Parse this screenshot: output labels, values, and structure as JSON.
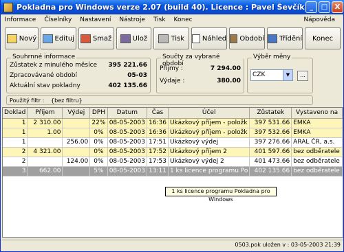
{
  "window": {
    "title": "Pokladna pro Windows verze 2.07 (build 40). Licence : Pavel Ševčík",
    "buttons": [
      "_",
      "□",
      "X"
    ]
  },
  "menu": {
    "items": [
      "Informace",
      "Číselníky",
      "Nastavení",
      "Nástroje",
      "Tisk",
      "Konec"
    ],
    "help": "Nápověda"
  },
  "toolbar": {
    "new": "Nový",
    "edit": "Edituj",
    "delete": "Smaž",
    "save": "Ulož",
    "print": "Tisk",
    "preview": "Náhled",
    "period": "Období",
    "sort": "Třídění",
    "exit": "Konec"
  },
  "summary": {
    "title": "Souhrnné informace",
    "rows": [
      {
        "label": "Zůstatek z minulého měsíce",
        "value": "395 221.66"
      },
      {
        "label": "Zpracovávané období",
        "value": "05-03"
      },
      {
        "label": "Aktuální stav pokladny",
        "value": "402 135.66"
      }
    ]
  },
  "sums": {
    "title": "Součty za vybrané období",
    "income_label": "Příjmy :",
    "income_value": "7 294.00",
    "expense_label": "Výdaje :",
    "expense_value": "380.00"
  },
  "currency": {
    "title": "Výběr měny",
    "selected": "CZK",
    "button": "..."
  },
  "filter": {
    "label": "Použitý filtr :",
    "value": "{bez filtru}"
  },
  "table": {
    "columns": [
      "Doklad",
      "Příjem",
      "Výdej",
      "DPH",
      "Datum",
      "Čas",
      "Účel",
      "Zůstatek",
      "Vystaveno na"
    ],
    "rows": [
      {
        "doklad": "1",
        "prijem": "2 310.00",
        "vydej": "",
        "dph": "22%",
        "datum": "08-05-2003",
        "cas": "16:36",
        "ucel": "Ukázkový příjem - položk",
        "zustatek": "397 531.66",
        "vystaveno": "EMKA",
        "style": "yellow"
      },
      {
        "doklad": "1",
        "prijem": "1.00",
        "vydej": "",
        "dph": "0%",
        "datum": "08-05-2003",
        "cas": "16:36",
        "ucel": "Ukázkový příjem - položk",
        "zustatek": "397 532.66",
        "vystaveno": "EMKA",
        "style": "yellow"
      },
      {
        "doklad": "1",
        "prijem": "",
        "vydej": "256.00",
        "dph": "0%",
        "datum": "08-05-2003",
        "cas": "17:51",
        "ucel": "Ukázkový výdej",
        "zustatek": "397 276.66",
        "vystaveno": "ARAL ČR, a.s.",
        "style": "white"
      },
      {
        "doklad": "2",
        "prijem": "4 321.00",
        "vydej": "",
        "dph": "0%",
        "datum": "08-05-2003",
        "cas": "17:52",
        "ucel": "Ukázkový příjem 2",
        "zustatek": "401 597.66",
        "vystaveno": "bez odběratele",
        "style": "yellow"
      },
      {
        "doklad": "2",
        "prijem": "",
        "vydej": "124.00",
        "dph": "0%",
        "datum": "08-05-2003",
        "cas": "17:53",
        "ucel": "Ukázkový výdej 2",
        "zustatek": "401 473.66",
        "vystaveno": "bez odběratele",
        "style": "white"
      },
      {
        "doklad": "3",
        "prijem": "662.00",
        "vydej": "",
        "dph": "5%",
        "datum": "08-05-2003",
        "cas": "13:11",
        "ucel": "1 ks licence programu Po",
        "zustatek": "402 135.66",
        "vystaveno": "bez odběratele",
        "style": "sel"
      }
    ]
  },
  "tooltip": "1 ks licence programu Pokladna pro Windows",
  "status": "0503.pok uložen v : 03-05-2003 21:39"
}
